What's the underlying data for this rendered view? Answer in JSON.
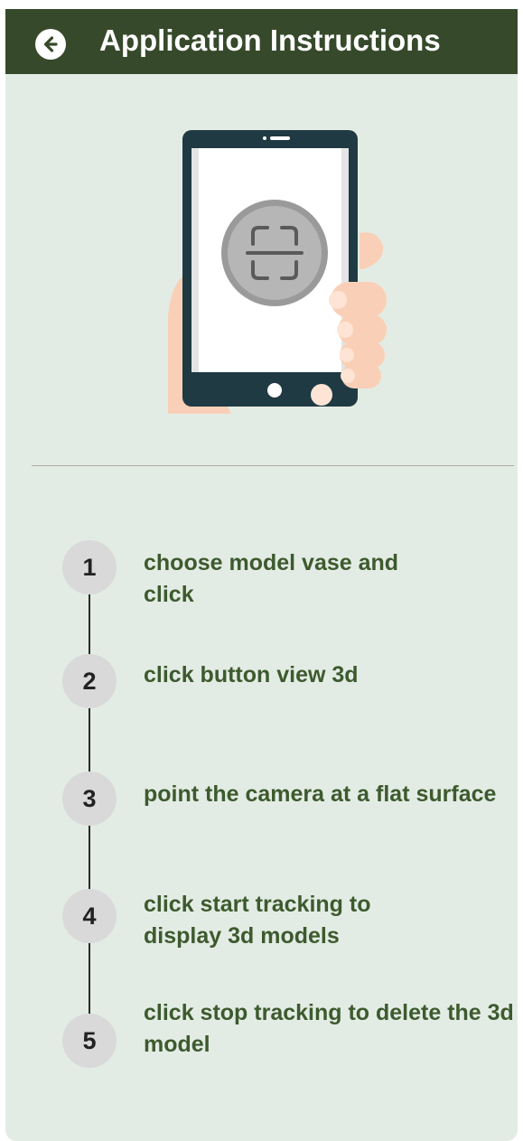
{
  "app_bar": {
    "title": "Application Instructions",
    "back_icon": "arrow-left-icon"
  },
  "illustration": {
    "subject": "hand-holding-phone-with-scan-icon",
    "scan_icon": "scan-frame-icon"
  },
  "steps": [
    {
      "number": "1",
      "text": "choose model vase and click"
    },
    {
      "number": "2",
      "text": "click button view 3d"
    },
    {
      "number": "3",
      "text": "point the camera at a flat surface"
    },
    {
      "number": "4",
      "text": "click start tracking to display 3d models"
    },
    {
      "number": "5",
      "text": "click stop tracking to delete the 3d model"
    }
  ],
  "colors": {
    "app_bar": "#364a2b",
    "background": "#e3ece4",
    "step_text": "#3d5a2e",
    "step_circle": "#d9d9d9"
  }
}
